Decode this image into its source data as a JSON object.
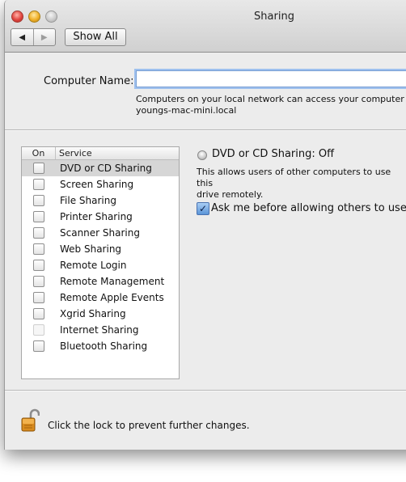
{
  "window": {
    "title": "Sharing"
  },
  "toolbar": {
    "show_all_label": "Show All",
    "back_glyph": "◀",
    "forward_glyph": "▶"
  },
  "computer_name": {
    "label": "Computer Name:",
    "value": "",
    "help_line1": "Computers on your local network can access your computer at",
    "help_line2": "youngs-mac-mini.local"
  },
  "services": {
    "header_on": "On",
    "header_service": "Service",
    "items": [
      {
        "label": "DVD or CD Sharing",
        "checked": false,
        "selected": true
      },
      {
        "label": "Screen Sharing",
        "checked": false
      },
      {
        "label": "File Sharing",
        "checked": false
      },
      {
        "label": "Printer Sharing",
        "checked": false
      },
      {
        "label": "Scanner Sharing",
        "checked": false
      },
      {
        "label": "Web Sharing",
        "checked": false
      },
      {
        "label": "Remote Login",
        "checked": false
      },
      {
        "label": "Remote Management",
        "checked": false
      },
      {
        "label": "Remote Apple Events",
        "checked": false
      },
      {
        "label": "Xgrid Sharing",
        "checked": false
      },
      {
        "label": "Internet Sharing",
        "checked": false,
        "disabled": true
      },
      {
        "label": "Bluetooth Sharing",
        "checked": false
      }
    ]
  },
  "detail": {
    "status": "DVD or CD Sharing: Off",
    "description_line1": "This allows users of other computers to use this",
    "description_line2": "drive remotely.",
    "ask_label": "Ask me before allowing others to use m",
    "ask_checked": true
  },
  "lock": {
    "text": "Click the lock to prevent further changes."
  },
  "colors": {
    "selection": "#d6d6d6",
    "focus_ring": "#9ec0ee",
    "checkbox_accent": "#5b95d8"
  }
}
